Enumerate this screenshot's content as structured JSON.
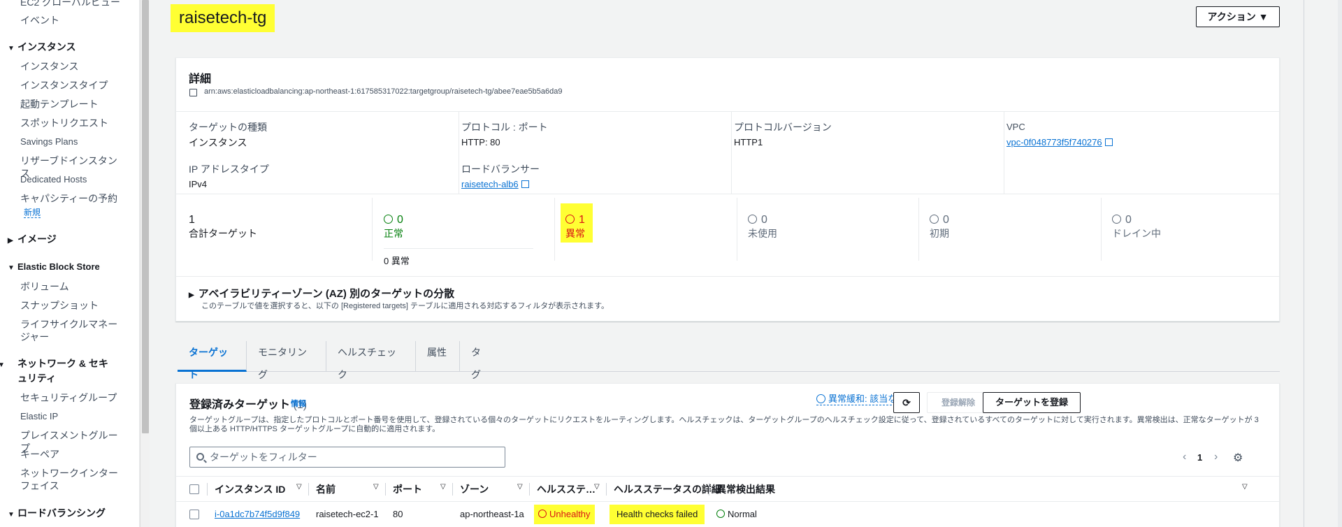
{
  "sidebar": {
    "top_items": [
      "EC2 グローバルビュー",
      "イベント"
    ],
    "sections": [
      {
        "title": "インスタンス",
        "expanded": true,
        "items": [
          "インスタンス",
          "インスタンスタイプ",
          "起動テンプレート",
          "スポットリクエスト",
          "Savings Plans",
          "リザーブドインスタンス",
          "Dedicated Hosts",
          "キャパシティーの予約"
        ]
      },
      {
        "title": "イメージ",
        "expanded": false,
        "items": []
      },
      {
        "title": "Elastic Block Store",
        "expanded": true,
        "items": [
          "ボリューム",
          "スナップショット",
          "ライフサイクルマネージャー"
        ]
      },
      {
        "title": "ネットワーク & セキュリティ",
        "expanded": true,
        "items": [
          "セキュリティグループ",
          "Elastic IP",
          "プレイスメントグループ",
          "キーペア",
          "ネットワークインターフェイス"
        ]
      },
      {
        "title": "ロードバランシング",
        "expanded": true,
        "items": []
      }
    ],
    "new_badge": "新規"
  },
  "header": {
    "title": "raisetech-tg",
    "actions_label": "アクション"
  },
  "details": {
    "heading": "詳細",
    "arn": "arn:aws:elasticloadbalancing:ap-northeast-1:617585317022:targetgroup/raisetech-tg/abee7eae5b5a6da9",
    "target_type_label": "ターゲットの種類",
    "target_type_value": "インスタンス",
    "protocol_port_label": "プロトコル : ポート",
    "protocol_port_value": "HTTP: 80",
    "protocol_version_label": "プロトコルバージョン",
    "protocol_version_value": "HTTP1",
    "vpc_label": "VPC",
    "vpc_value": "vpc-0f048773f5f740276",
    "ip_type_label": "IP アドレスタイプ",
    "ip_type_value": "IPv4",
    "lb_label": "ロードバランサー",
    "lb_value": "raisetech-alb6"
  },
  "counts": {
    "total_value": "1",
    "total_label": "合計ターゲット",
    "healthy_value": "0",
    "healthy_label": "正常",
    "healthy_anomaly": "0 異常",
    "unhealthy_value": "1",
    "unhealthy_label": "異常",
    "unused_value": "0",
    "unused_label": "未使用",
    "initial_value": "0",
    "initial_label": "初期",
    "draining_value": "0",
    "draining_label": "ドレイン中"
  },
  "az": {
    "title": "アベイラビリティーゾーン (AZ) 別のターゲットの分散",
    "description": "このテーブルで値を選択すると、以下の [Registered targets] テーブルに適用される対応するフィルタが表示されます。"
  },
  "tabs": [
    "ターゲット",
    "モニタリング",
    "ヘルスチェック",
    "属性",
    "タグ"
  ],
  "targets": {
    "title": "登録済みターゲット",
    "count": "(1)",
    "info": "情報",
    "mitigation": "異常緩和: 該当なし",
    "deregister": "登録解除",
    "register": "ターゲットを登録",
    "description": "ターゲットグループは、指定したプロトコルとポート番号を使用して、登録されている個々のターゲットにリクエストをルーティングします。ヘルスチェックは、ターゲットグループのヘルスチェック設定に従って、登録されているすべてのターゲットに対して実行されます。異常検出は、正常なターゲットが 3 個以上ある HTTP/HTTPS ターゲットグループに自動的に適用されます。",
    "filter_placeholder": "ターゲットをフィルター",
    "page": "1",
    "columns": [
      "インスタンス ID",
      "名前",
      "ポート",
      "ゾーン",
      "ヘルスステ…",
      "ヘルスステータスの詳細",
      "異常検出結果"
    ],
    "rows": [
      {
        "instance_id": "i-0a1dc7b74f5d9f849",
        "name": "raisetech-ec2-1",
        "port": "80",
        "zone": "ap-northeast-1a",
        "health": "Unhealthy",
        "health_detail": "Health checks failed",
        "anomaly": "Normal"
      }
    ]
  },
  "colors": {
    "link": "#0972d3",
    "error": "#d91515",
    "success": "#037f0c",
    "highlight": "#ffff33"
  }
}
